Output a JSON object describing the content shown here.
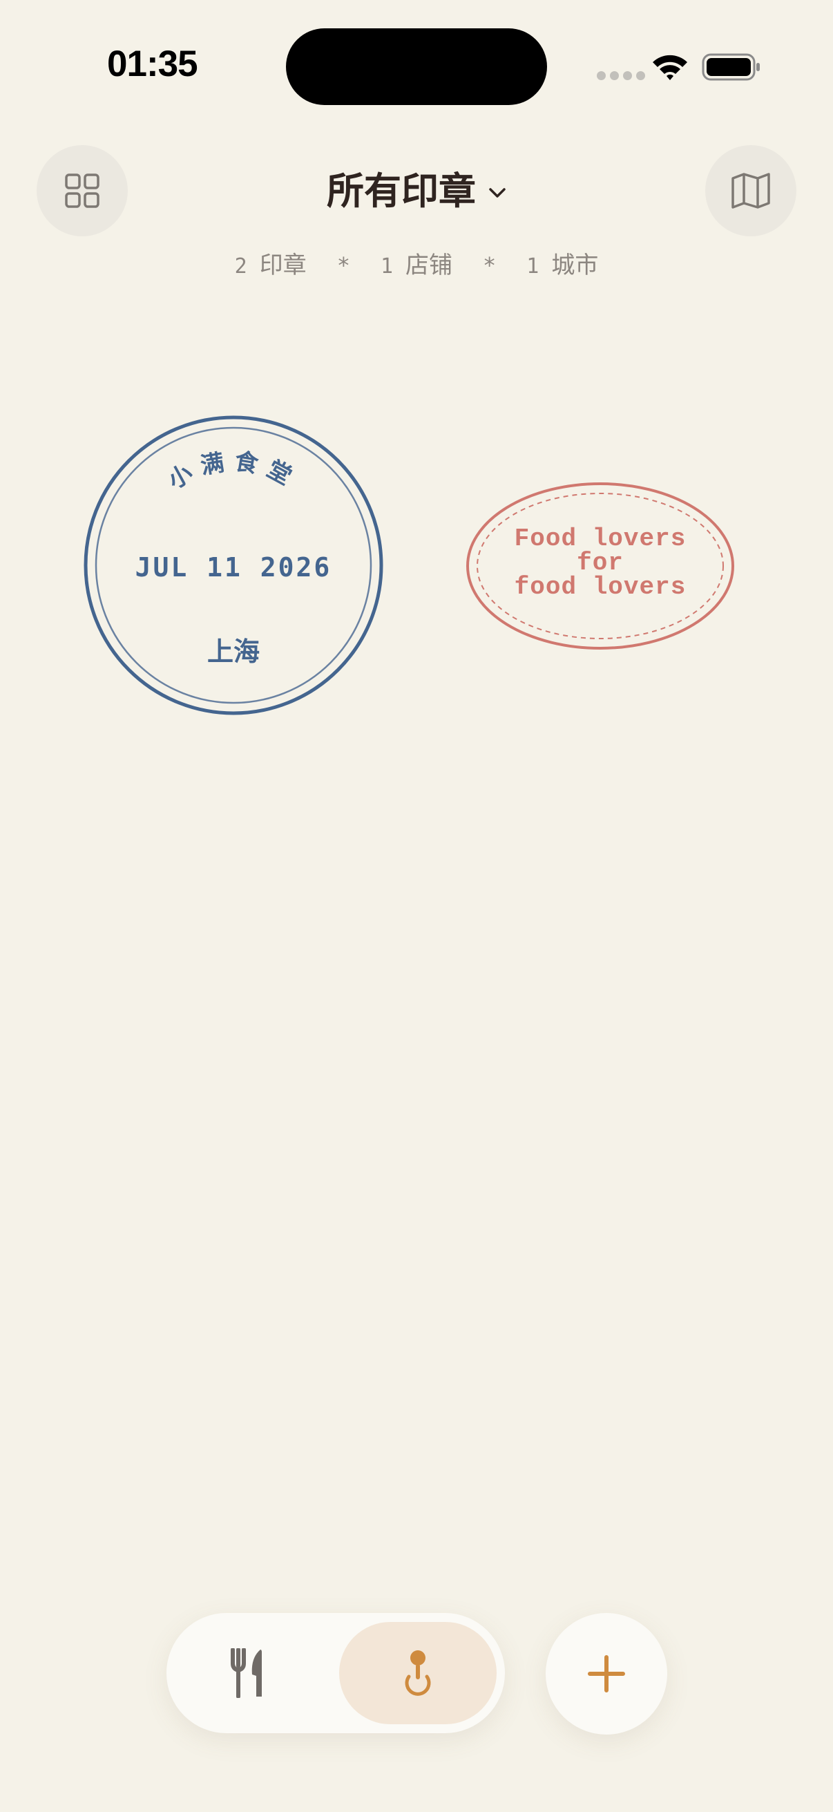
{
  "status_bar": {
    "time": "01:35"
  },
  "header": {
    "title": "所有印章",
    "left_icon": "grid-icon",
    "right_icon": "map-icon"
  },
  "summary": {
    "stamp_count": "2",
    "stamp_label": "印章",
    "store_count": "1",
    "store_label": "店铺",
    "city_count": "1",
    "city_label": "城市",
    "separator": "*"
  },
  "stamps": [
    {
      "shape": "circle",
      "top_text": "小满食堂",
      "date": "JUL 11 2026",
      "city": "上海",
      "color": "#44658f"
    },
    {
      "shape": "oval",
      "lines": [
        "Food lovers",
        "for",
        "food lovers"
      ],
      "color": "#d0786f"
    }
  ],
  "tab_bar": {
    "tabs": [
      {
        "icon": "fork-knife-icon",
        "active": false
      },
      {
        "icon": "stamp-icon",
        "active": true
      }
    ],
    "add_icon": "plus-icon"
  },
  "colors": {
    "background": "#f5f2e8",
    "accent": "#cf8b3f",
    "title": "#2f2420",
    "muted": "#8c8680",
    "active_tab_bg": "#f3e6d7"
  }
}
